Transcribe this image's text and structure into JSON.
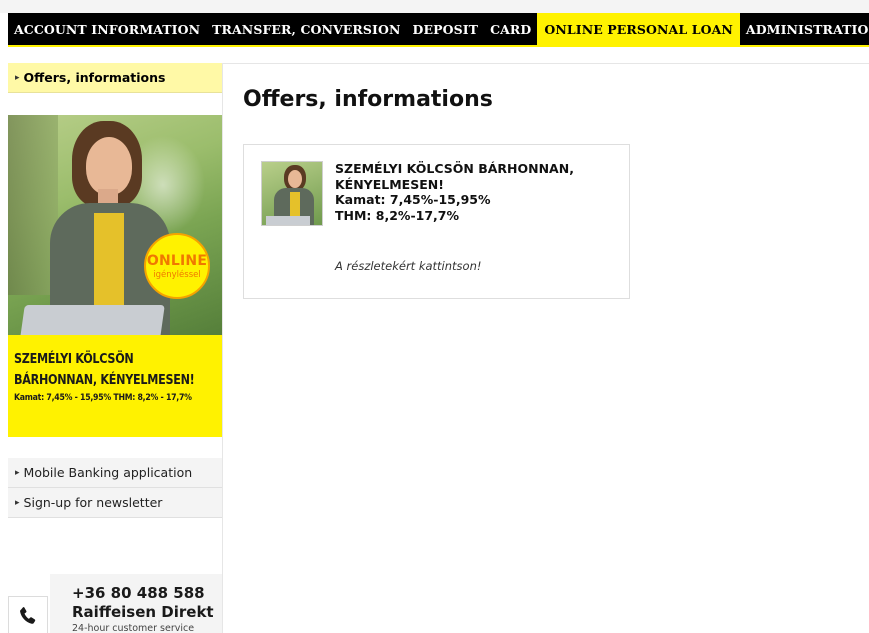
{
  "nav": {
    "items": [
      {
        "label": "ACCOUNT INFORMATION",
        "active": false
      },
      {
        "label": "TRANSFER, CONVERSION",
        "active": false
      },
      {
        "label": "DEPOSIT",
        "active": false
      },
      {
        "label": "CARD",
        "active": false
      },
      {
        "label": "ONLINE PERSONAL LOAN",
        "active": true
      },
      {
        "label": "ADMINISTRATION",
        "active": false
      }
    ]
  },
  "sidebar": {
    "active_item": "Offers, informations",
    "promo": {
      "badge_main": "ONLINE",
      "badge_sub": "igényléssel",
      "title_line1": "SZEMÉLYI KÖLCSÖN",
      "title_line2": "BÁRHONNAN, KÉNYELMESEN!",
      "rates": "Kamat: 7,45% - 15,95%  THM: 8,2% - 17,7%"
    },
    "links": [
      {
        "label": "Mobile Banking application"
      },
      {
        "label": "Sign-up for newsletter"
      }
    ],
    "contact": {
      "phone": "+36 80 488 588",
      "name": "Raiffeisen Direkt",
      "subtitle": "24-hour customer service"
    }
  },
  "main": {
    "title": "Offers, informations",
    "offer": {
      "line1": "SZEMÉLYI KÖLCSÖN BÁRHONNAN,",
      "line2": "KÉNYELMESEN!",
      "line3": "Kamat: 7,45%-15,95%",
      "line4": "THM: 8,2%-17,7%",
      "link_text": "A részletekért kattintson!"
    }
  },
  "colors": {
    "brand_yellow": "#fff200",
    "nav_black": "#000000",
    "active_side_bg": "#fff9a6",
    "badge_orange": "#f07800"
  }
}
